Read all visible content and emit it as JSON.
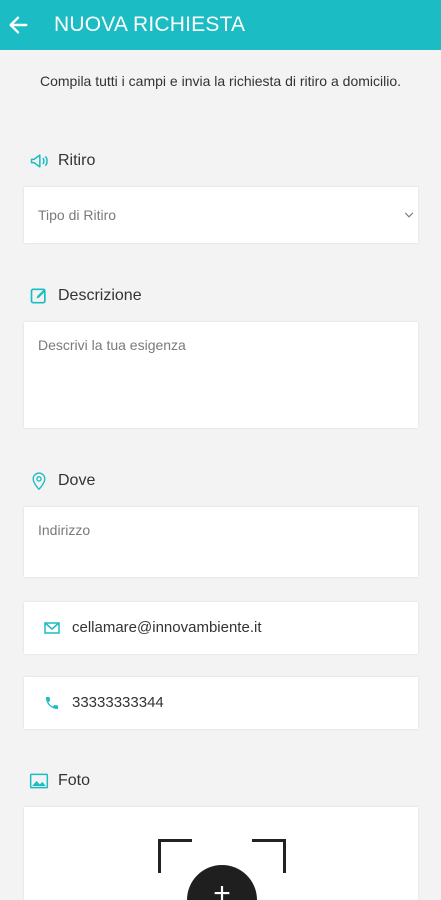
{
  "header": {
    "title": "NUOVA RICHIESTA"
  },
  "intro": "Compila tutti i campi e invia la richiesta di ritiro a domicilio.",
  "ritiro": {
    "label": "Ritiro",
    "select_value": "Tipo di Ritiro"
  },
  "descrizione": {
    "label": "Descrizione",
    "placeholder": "Descrivi la tua esigenza"
  },
  "dove": {
    "label": "Dove",
    "placeholder": "Indirizzo"
  },
  "email": {
    "value": "cellamare@innovambiente.it"
  },
  "phone": {
    "value": "33333333344"
  },
  "foto": {
    "label": "Foto",
    "add_symbol": "+"
  },
  "colors": {
    "accent": "#1bbcc3",
    "background": "#f3f3f3"
  }
}
